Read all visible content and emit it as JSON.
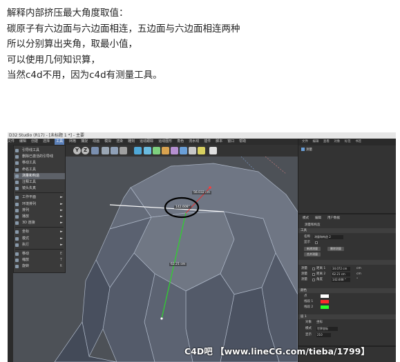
{
  "intro_lines": [
    "解释内部挤压最大角度取值：",
    "碳原子有六边面与六边面相连，五边面与六边面相连两种",
    "所以分别算出夹角，取最小值，",
    "可以使用几何知识算，",
    "当然c4d不用，因为c4d有测量工具。"
  ],
  "app": {
    "title": "D32 Studio (R17) - [未标题 1 *] - 主要",
    "menu": [
      "文件",
      "编辑",
      "创建",
      "选择",
      "工具",
      "网格",
      "捕捉",
      "动画",
      "模拟",
      "渲染",
      "雕刻",
      "运动跟踪",
      "运动图形",
      "角色",
      "流水线",
      "插件",
      "脚本",
      "窗口",
      "帮助"
    ],
    "active_menu_index": 4,
    "toolbar_letters": [
      "Y",
      "Z"
    ]
  },
  "tools_menu": {
    "items": [
      {
        "label": "引导线工具",
        "arrow": "",
        "key": ""
      },
      {
        "label": "删除已激活的引导线",
        "arrow": "",
        "key": ""
      },
      {
        "label": "移动工具",
        "arrow": "",
        "key": ""
      },
      {
        "label": "命名工具",
        "arrow": "",
        "key": ""
      },
      {
        "label": "测量和构造",
        "arrow": "",
        "key": "",
        "selected": true
      },
      {
        "label": "注释工具",
        "arrow": "",
        "key": ""
      },
      {
        "label": "镜头失真",
        "arrow": "",
        "key": ""
      },
      {
        "label": "工作平面",
        "arrow": "►",
        "key": ""
      },
      {
        "label": "环境排列",
        "arrow": "►",
        "key": ""
      },
      {
        "label": "排列",
        "arrow": "►",
        "key": ""
      },
      {
        "label": "播放",
        "arrow": "►",
        "key": ""
      },
      {
        "label": "3D 连接",
        "arrow": "►",
        "key": ""
      },
      {
        "label": "坐标",
        "arrow": "►",
        "key": ""
      },
      {
        "label": "模式",
        "arrow": "►",
        "key": ""
      },
      {
        "label": "执行",
        "arrow": "►",
        "key": ""
      },
      {
        "label": "移动",
        "arrow": "",
        "key": "E"
      },
      {
        "label": "缩放",
        "arrow": "",
        "key": "T"
      },
      {
        "label": "旋转",
        "arrow": "",
        "key": "R"
      }
    ]
  },
  "viewport": {
    "measure_distance_top": "56.032 cm",
    "measure_angle": "142.608°",
    "measure_distance_line": "62.21 cm"
  },
  "right_panel": {
    "top_tabs": [
      "文件",
      "编辑",
      "查看",
      "对象",
      "标签",
      "书签"
    ],
    "object_name": "测量",
    "attr_tabs": [
      "模式",
      "编辑",
      "用户数据"
    ],
    "attr_title": "测量和构造",
    "section_tool": "工具",
    "row_name_label": "名称",
    "row_name_value": "测量和构造 2",
    "row_show_label": "显示",
    "btn_new": "新建测量",
    "btn_delete": "删除测量",
    "btn_copy": "合并测量",
    "measure_rows": [
      {
        "label": "测量",
        "sub": "距离 1",
        "value": "34.072 cm",
        "unit": "cm"
      },
      {
        "label": "测量",
        "sub": "距离 2",
        "value": "62.21 cm",
        "unit": "cm"
      },
      {
        "label": "测量",
        "sub": "角度",
        "value": "142.608 °",
        "unit": "°"
      }
    ],
    "section_color": "颜色",
    "color_rows": [
      {
        "label": "点",
        "color": "#ffffff"
      },
      {
        "label": "线段 1",
        "color": "#ff2a2a"
      },
      {
        "label": "线段 2",
        "color": "#2aff2a"
      }
    ],
    "section_axis": "层 1",
    "axis_rows": [
      {
        "label": "对象",
        "value": "坐标"
      },
      {
        "label": "模式",
        "value": "世界坐标"
      },
      {
        "label": "显示",
        "value": "210"
      }
    ]
  },
  "watermark": "C4D吧 【www.lineCG.com/tieba/1799】"
}
